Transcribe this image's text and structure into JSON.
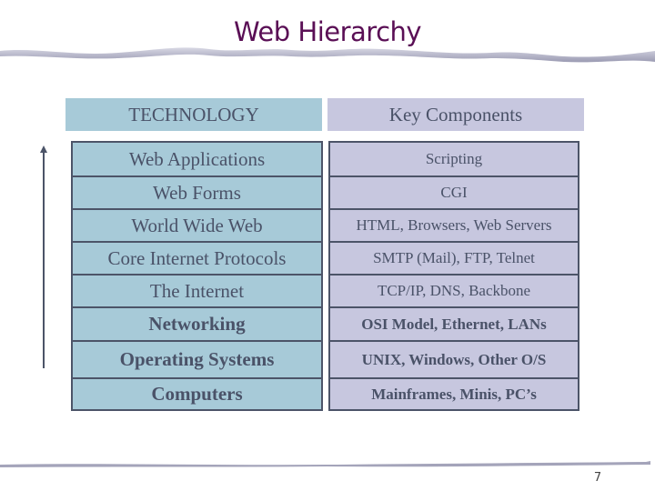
{
  "slide": {
    "title": "Web Hierarchy",
    "page_number": "7"
  },
  "table": {
    "headers": {
      "technology": "TECHNOLOGY",
      "key_components": "Key Components"
    },
    "rows": [
      {
        "technology": "Web Applications",
        "key_components": "Scripting",
        "bold": false
      },
      {
        "technology": "Web Forms",
        "key_components": "CGI",
        "bold": false
      },
      {
        "technology": "World Wide Web",
        "key_components": "HTML, Browsers, Web Servers",
        "bold": false
      },
      {
        "technology": "Core Internet Protocols",
        "key_components": "SMTP (Mail), FTP, Telnet",
        "bold": false
      },
      {
        "technology": "The Internet",
        "key_components": "TCP/IP, DNS, Backbone",
        "bold": false
      },
      {
        "technology": "Networking",
        "key_components": "OSI Model, Ethernet, LANs",
        "bold": true
      },
      {
        "technology": "Operating Systems",
        "key_components": "UNIX, Windows, Other O/S",
        "bold": true
      },
      {
        "technology": "Computers",
        "key_components": "Mainframes, Minis, PC’s",
        "bold": true
      }
    ]
  },
  "colors": {
    "title": "#5a0f55",
    "technology_fill": "#a7cad8",
    "key_components_fill": "#c7c7df",
    "border": "#4c5468",
    "text": "#4a5268"
  },
  "icons": {
    "hierarchy_arrow": "up-arrow-icon"
  }
}
